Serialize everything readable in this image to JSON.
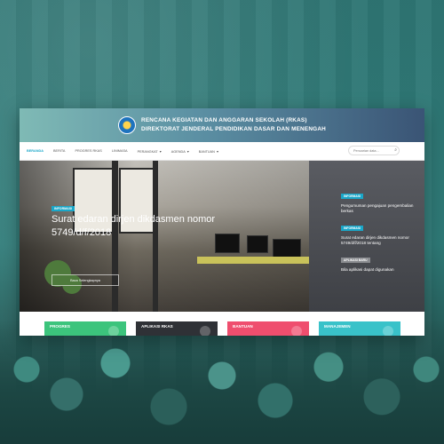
{
  "header": {
    "title_line1": "RENCANA KEGIATAN DAN ANGGARAN SEKOLAH (RKAS)",
    "title_line2": "DIREKTORAT JENDERAL PENDIDIKAN DASAR DAN MENENGAH"
  },
  "nav": {
    "items": [
      "BERANDA",
      "BERITA",
      "PROGRES RKAS",
      "LINIMASA",
      "PERANGKAT",
      "AGENDA",
      "BANTUAN"
    ],
    "search_placeholder": "Pencarian data..."
  },
  "hero": {
    "badge": "INFORMASI",
    "headline": "Surat edaran dirjen dikdasmen nomor 5749/d/f/2018",
    "button": "Baca Selengkapnya"
  },
  "side": {
    "items": [
      {
        "badge": "INFORMASI",
        "text": "Pengumuman pengajuan pengembalian berkas"
      },
      {
        "badge": "INFORMASI",
        "text": "Surat edaran dirjen dikdasmen nomor 5749/d/f/2018 tentang"
      },
      {
        "badge": "APLIKASI BARU",
        "text": "Bila aplikasi dapat digunakan"
      }
    ]
  },
  "cards": [
    {
      "label": "PROGRES",
      "color": "#3cc47c"
    },
    {
      "label": "APLIKASI RKAS",
      "color": "#2f3136"
    },
    {
      "label": "BANTUAN",
      "color": "#ef4e6e"
    },
    {
      "label": "MANAJEMEN",
      "color": "#39c2c9"
    }
  ]
}
